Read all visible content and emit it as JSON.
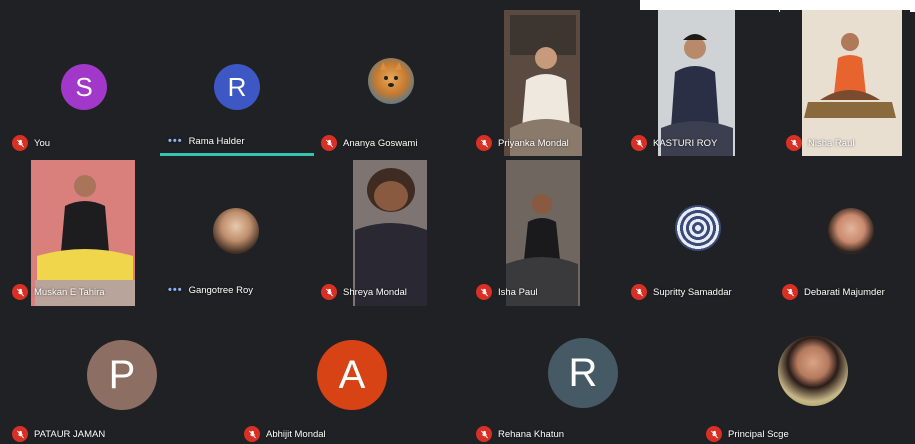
{
  "meeting": {
    "participants": [
      {
        "name": "You",
        "initial": "S",
        "color": "#a238c9"
      },
      {
        "name": "Rama Halder",
        "initial": "R",
        "color": "#3d57c4"
      },
      {
        "name": "Ananya Goswami"
      },
      {
        "name": "Priyanka Mondal"
      },
      {
        "name": "KASTURI ROY"
      },
      {
        "name": "Nisha Raul"
      },
      {
        "name": "Muskan E Tahira"
      },
      {
        "name": "Gangotree Roy"
      },
      {
        "name": "Shreya Mondal"
      },
      {
        "name": "Isha Paul"
      },
      {
        "name": "Supritty Samaddar"
      },
      {
        "name": "Debarati Majumder"
      },
      {
        "name": "PATAUR JAMAN",
        "initial": "P",
        "color": "#8d6e63"
      },
      {
        "name": "Abhijit Mondal",
        "initial": "A",
        "color": "#d84315"
      },
      {
        "name": "Rehana Khatun",
        "initial": "R",
        "color": "#455a64"
      },
      {
        "name": "Principal Scge"
      }
    ]
  }
}
